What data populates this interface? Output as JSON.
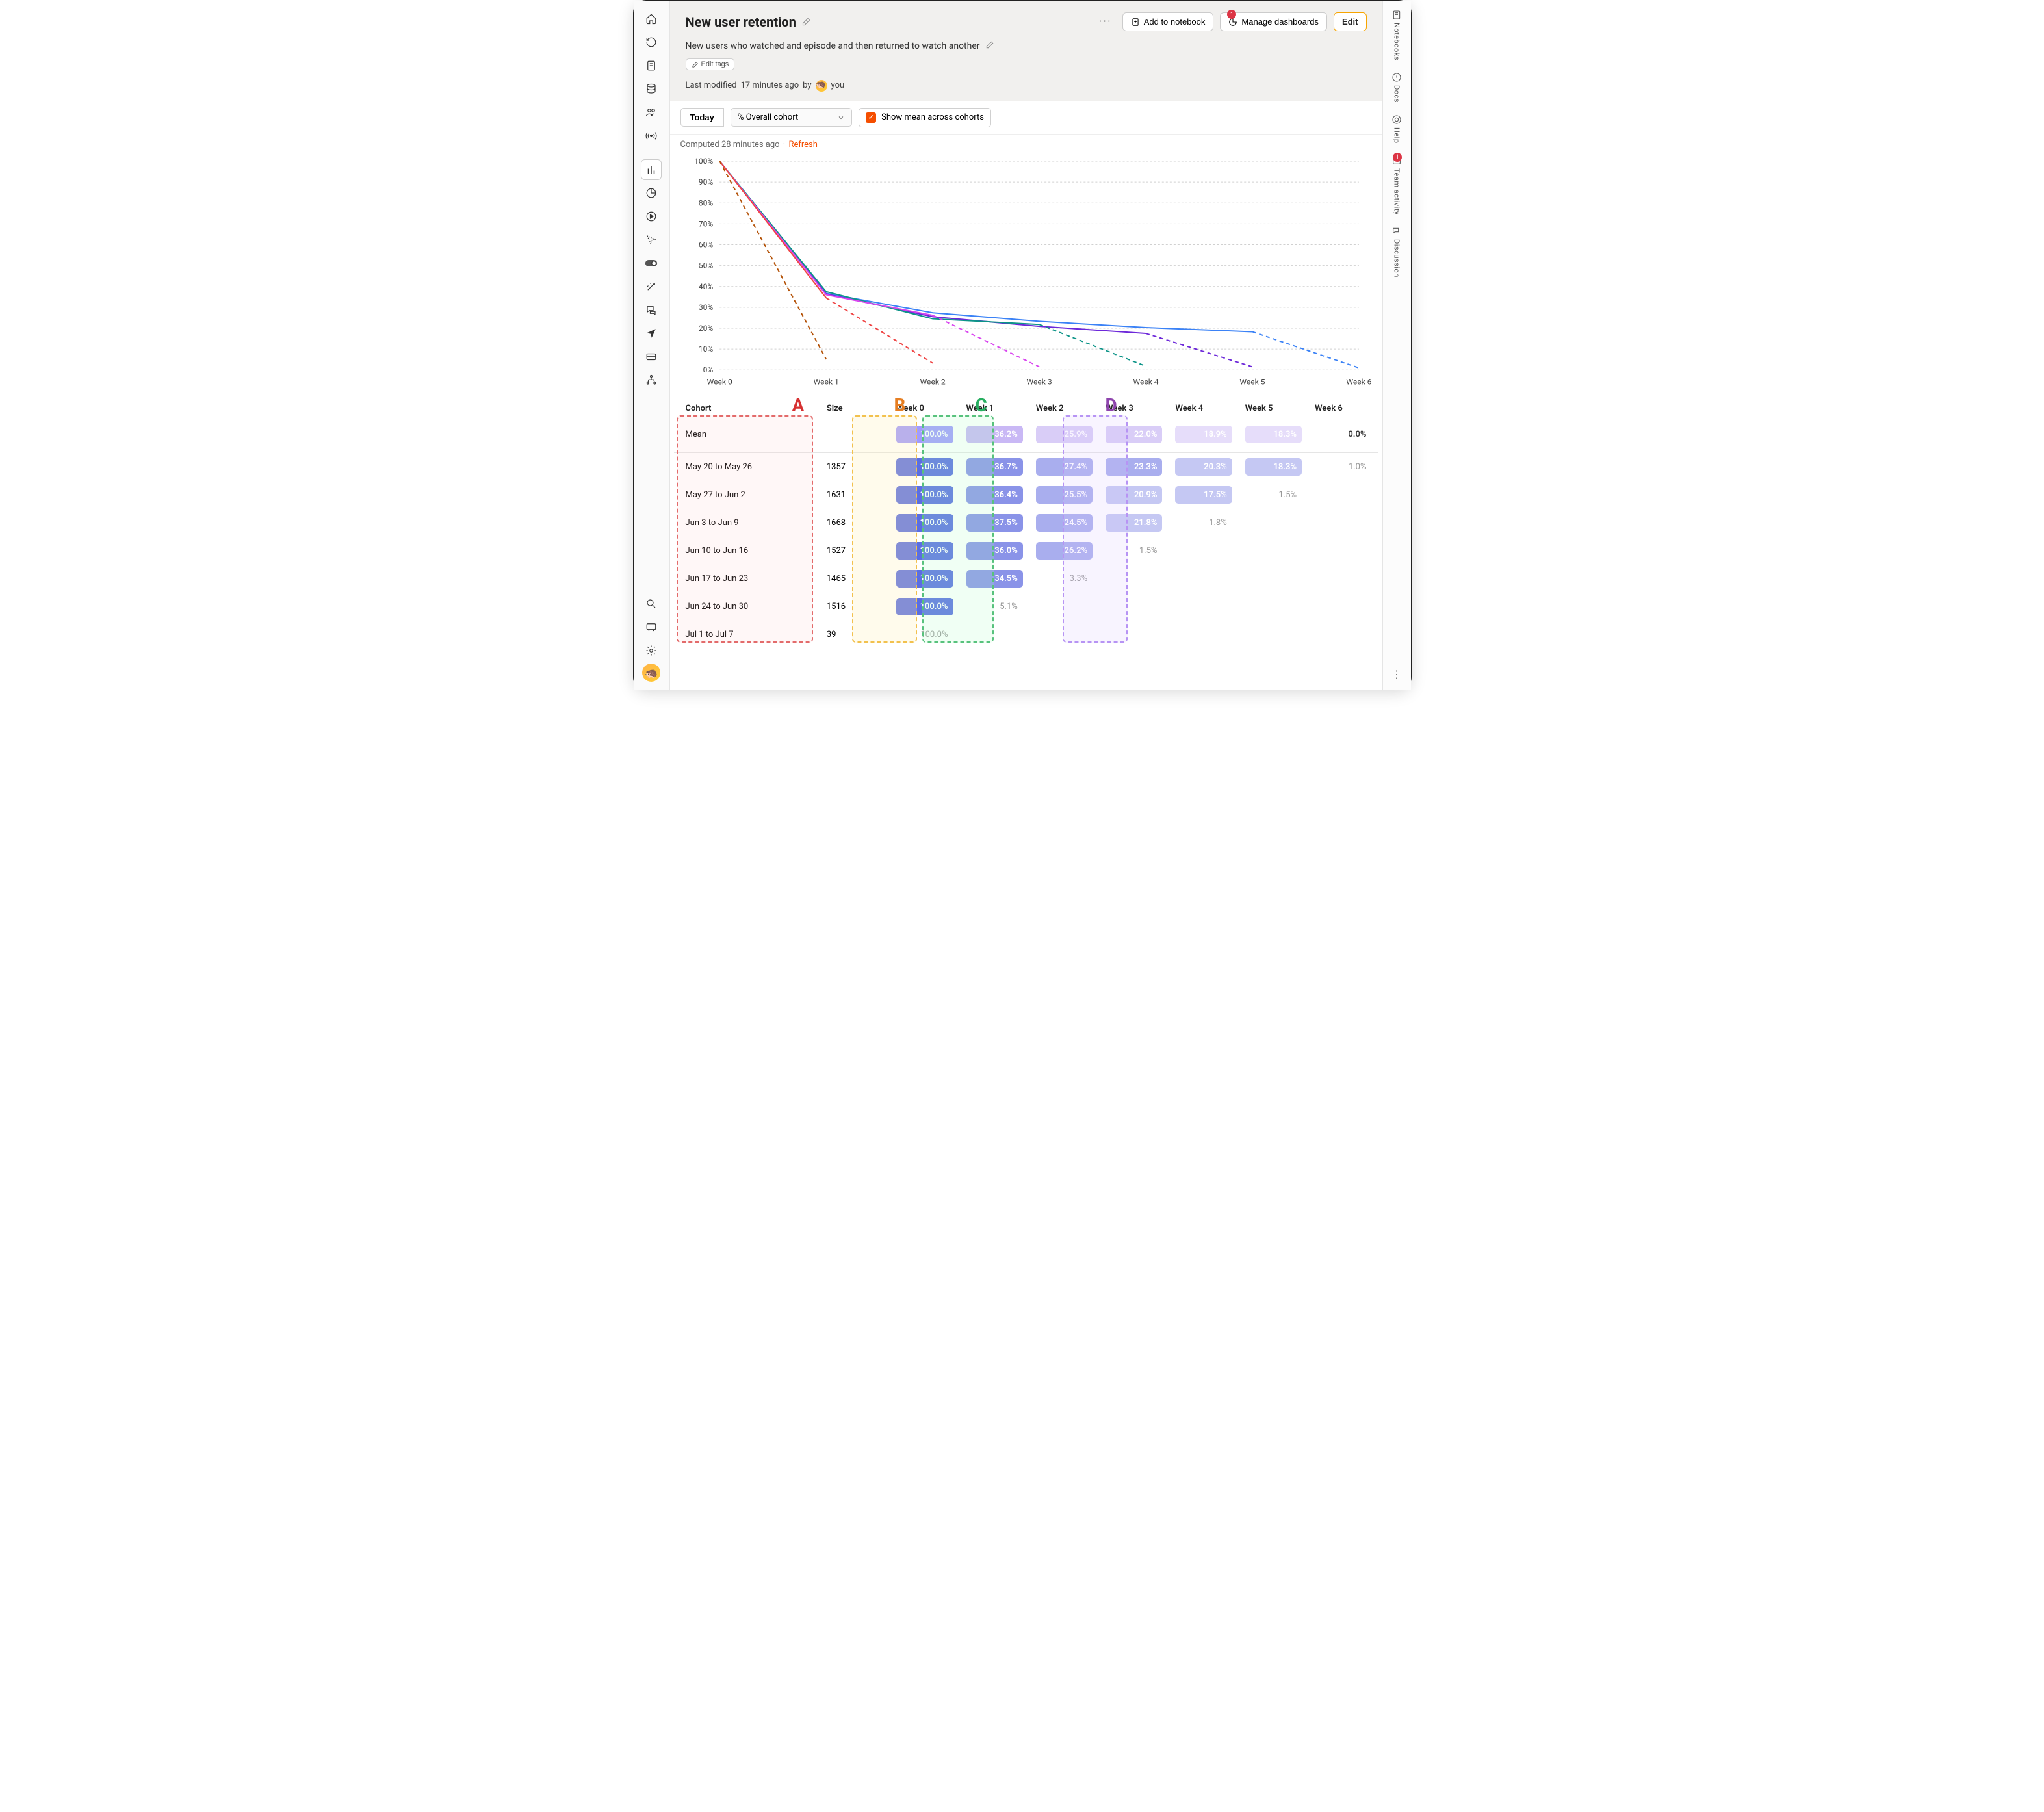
{
  "header": {
    "title": "New user retention",
    "desc": "New users who watched and episode and then returned to watch another",
    "edit_tags": "Edit tags",
    "modified_prefix": "Last modified",
    "modified_time": "17 minutes ago",
    "modified_by": "by",
    "modified_who": "you",
    "add_notebook": "Add to notebook",
    "manage_dashboards": "Manage dashboards",
    "manage_badge": "1",
    "edit": "Edit"
  },
  "controls": {
    "today": "Today",
    "overall_option": "% Overall cohort",
    "show_mean": "Show mean across cohorts"
  },
  "computed": {
    "text": "Computed 28 minutes ago",
    "sep": "·",
    "refresh": "Refresh"
  },
  "rightRail": {
    "notebooks": "Notebooks",
    "docs": "Docs",
    "help": "Help",
    "team_activity": "Team activity",
    "team_badge": "1",
    "discussion": "Discussion"
  },
  "chart_data": {
    "type": "line",
    "xlabel": "",
    "ylabel": "",
    "y_ticks": [
      "0%",
      "10%",
      "20%",
      "30%",
      "40%",
      "50%",
      "60%",
      "70%",
      "80%",
      "90%",
      "100%"
    ],
    "x_categories": [
      "Week 0",
      "Week 1",
      "Week 2",
      "Week 3",
      "Week 4",
      "Week 5",
      "Week 6"
    ],
    "series": [
      {
        "name": "May 20 to May 26",
        "color": "#3b82f6",
        "solid_until": 5,
        "values": [
          100.0,
          36.7,
          27.4,
          23.3,
          20.3,
          18.3,
          1.0
        ]
      },
      {
        "name": "May 27 to Jun 2",
        "color": "#6d28d9",
        "solid_until": 4,
        "values": [
          100.0,
          36.4,
          25.5,
          20.9,
          17.5,
          1.5,
          null
        ]
      },
      {
        "name": "Jun 3 to Jun 9",
        "color": "#0d9488",
        "solid_until": 3,
        "values": [
          100.0,
          37.5,
          24.5,
          21.8,
          1.8,
          null,
          null
        ]
      },
      {
        "name": "Jun 10 to Jun 16",
        "color": "#d946ef",
        "solid_until": 2,
        "values": [
          100.0,
          36.0,
          26.2,
          1.5,
          null,
          null,
          null
        ]
      },
      {
        "name": "Jun 17 to Jun 23",
        "color": "#ef4444",
        "solid_until": 1,
        "values": [
          100.0,
          34.5,
          3.3,
          null,
          null,
          null,
          null
        ]
      },
      {
        "name": "Jun 24 to Jun 30",
        "color": "#b45309",
        "solid_until": 0,
        "values": [
          100.0,
          5.1,
          null,
          null,
          null,
          null,
          null
        ]
      }
    ]
  },
  "table": {
    "headers": [
      "Cohort",
      "Size",
      "Week 0",
      "Week 1",
      "Week 2",
      "Week 3",
      "Week 4",
      "Week 5",
      "Week 6"
    ],
    "mean": {
      "label": "Mean",
      "size": "",
      "values": [
        "100.0%",
        "36.2%",
        "25.9%",
        "22.0%",
        "18.9%",
        "18.3%",
        "0.0%"
      ]
    },
    "rows": [
      {
        "cohort": "May 20 to May 26",
        "size": "1357",
        "values": [
          "100.0%",
          "36.7%",
          "27.4%",
          "23.3%",
          "20.3%",
          "18.3%",
          "1.0%"
        ]
      },
      {
        "cohort": "May 27 to Jun 2",
        "size": "1631",
        "values": [
          "100.0%",
          "36.4%",
          "25.5%",
          "20.9%",
          "17.5%",
          "1.5%",
          null
        ]
      },
      {
        "cohort": "Jun 3 to Jun 9",
        "size": "1668",
        "values": [
          "100.0%",
          "37.5%",
          "24.5%",
          "21.8%",
          "1.8%",
          null,
          null
        ]
      },
      {
        "cohort": "Jun 10 to Jun 16",
        "size": "1527",
        "values": [
          "100.0%",
          "36.0%",
          "26.2%",
          "1.5%",
          null,
          null,
          null
        ]
      },
      {
        "cohort": "Jun 17 to Jun 23",
        "size": "1465",
        "values": [
          "100.0%",
          "34.5%",
          "3.3%",
          null,
          null,
          null,
          null
        ]
      },
      {
        "cohort": "Jun 24 to Jun 30",
        "size": "1516",
        "values": [
          "100.0%",
          "5.1%",
          null,
          null,
          null,
          null,
          null
        ]
      },
      {
        "cohort": "Jul 1 to Jul 7",
        "size": "39",
        "values": [
          "100.0%",
          null,
          null,
          null,
          null,
          null,
          null
        ]
      }
    ]
  },
  "annotations": {
    "A": "A",
    "B": "B",
    "C": "C",
    "D": "D"
  }
}
